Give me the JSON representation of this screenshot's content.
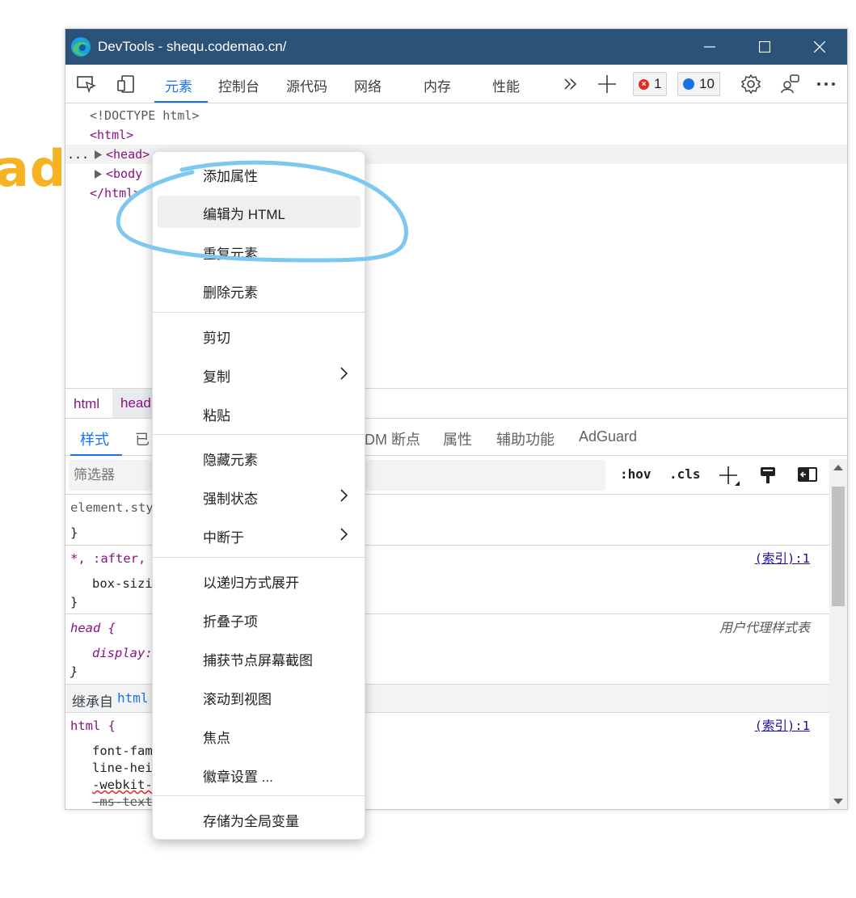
{
  "background": {
    "text": "adi"
  },
  "window": {
    "title": "DevTools - shequ.codemao.cn/",
    "controls": [
      "minimize",
      "maximize",
      "close"
    ]
  },
  "toolbar": {
    "tabs": [
      {
        "label": "元素",
        "active": true
      },
      {
        "label": "控制台",
        "active": false
      },
      {
        "label": "源代码",
        "active": false
      },
      {
        "label": "网络",
        "active": false
      },
      {
        "label": "内存",
        "active": false
      },
      {
        "label": "性能",
        "active": false
      }
    ],
    "error_count": "1",
    "message_count": "10"
  },
  "dom_tree": {
    "doctype": "<!DOCTYPE html>",
    "html_open": "<html>",
    "head_row": "<head>",
    "body_row": "<body",
    "html_close": "</html>",
    "ellipsis": "..."
  },
  "breadcrumbs": [
    "html",
    "head"
  ],
  "styles_tabs": [
    {
      "label": "样式",
      "active": true
    },
    {
      "label": "已",
      "active": false
    },
    {
      "label": "DM 断点",
      "active": false
    },
    {
      "label": "属性",
      "active": false
    },
    {
      "label": "辅助功能",
      "active": false
    },
    {
      "label": "AdGuard",
      "active": false
    }
  ],
  "filter": {
    "placeholder": "筛选器",
    "hov": ":hov",
    "cls": ".cls"
  },
  "styles": {
    "element_style": "element.sty",
    "brace_close": "}",
    "universal_selector": "*, :after,",
    "box_sizing": "box-sizi",
    "head_selector": "head {",
    "display": "display:",
    "user_agent": "用户代理样式表",
    "inherited_label": "继承自",
    "inherited_tag": "html",
    "html_selector": "html {",
    "font_family": "font-fam",
    "line_height": "line-hei",
    "webkit": "-webkit-",
    "ms_text": "-ms-text",
    "source_link": "(索引):1"
  },
  "context_menu": {
    "items": [
      {
        "label": "添加属性"
      },
      {
        "label": "编辑为 HTML",
        "highlighted": true
      },
      {
        "label": "重复元素"
      },
      {
        "label": "删除元素"
      },
      {
        "label": "剪切"
      },
      {
        "label": "复制",
        "submenu": true
      },
      {
        "label": "粘贴"
      },
      {
        "label": "隐藏元素"
      },
      {
        "label": "强制状态",
        "submenu": true
      },
      {
        "label": "中断于",
        "submenu": true
      },
      {
        "label": "以递归方式展开"
      },
      {
        "label": "折叠子项"
      },
      {
        "label": "捕获节点屏幕截图"
      },
      {
        "label": "滚动到视图"
      },
      {
        "label": "焦点"
      },
      {
        "label": "徽章设置 ..."
      },
      {
        "label": "存储为全局变量"
      }
    ]
  },
  "colors": {
    "titlebar": "#2b5278",
    "accent": "#1a73e8",
    "annotation": "#7cc8ee",
    "tag": "#881280",
    "background_text": "#f5b324"
  }
}
